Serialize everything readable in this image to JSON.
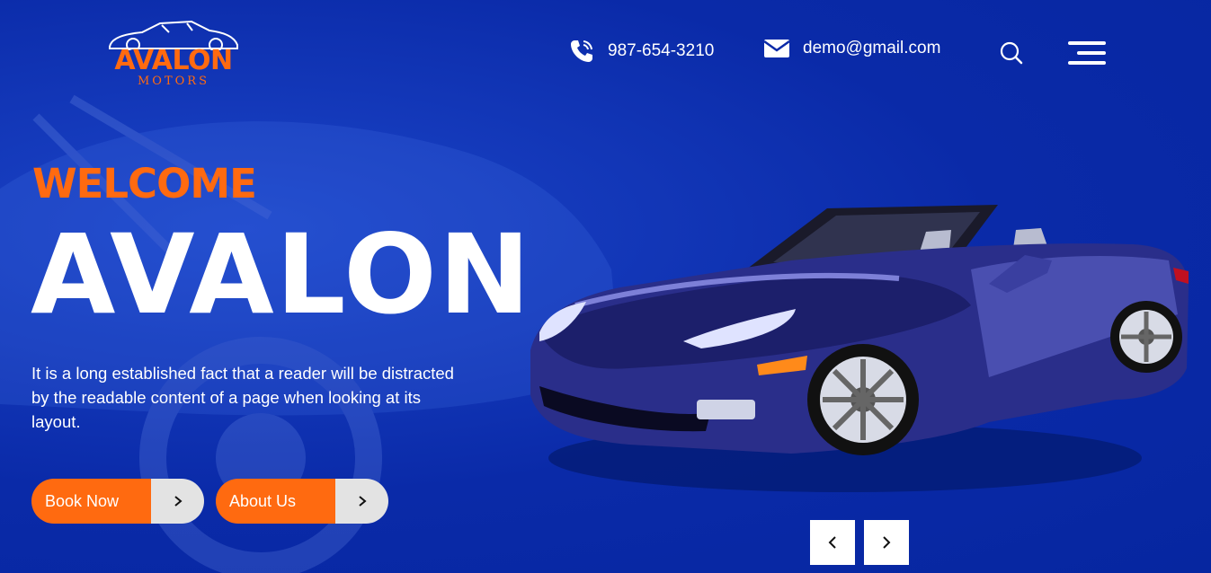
{
  "brand": {
    "logo_main": "AVALON",
    "logo_sub": "MOTORS"
  },
  "header": {
    "phone": "987-654-3210",
    "email": "demo@gmail.com",
    "icons": [
      "phone-icon",
      "mail-icon",
      "search-icon",
      "menu-icon"
    ]
  },
  "hero": {
    "welcome": "WELCOME",
    "title": "AVALON",
    "description": "It is a long established fact that a reader will be distracted by the readable content of a page when looking at its layout.",
    "buttons": [
      {
        "label": "Book Now",
        "icon": "chevron-right-icon"
      },
      {
        "label": "About Us",
        "icon": "chevron-right-icon"
      }
    ],
    "slider": {
      "prev_icon": "chevron-left-icon",
      "next_icon": "chevron-right-icon"
    }
  },
  "colors": {
    "background": "#0a2aa8",
    "accent": "#ff6a10",
    "button_secondary": "#e3e3e3",
    "text": "#ffffff"
  }
}
